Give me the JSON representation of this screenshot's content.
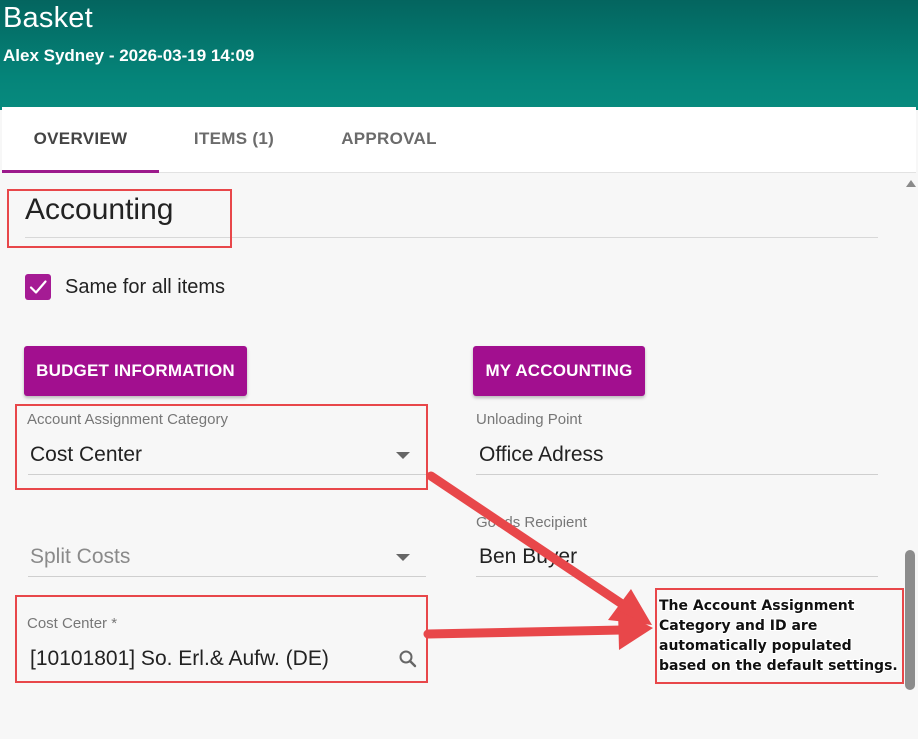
{
  "header": {
    "title": "Basket",
    "subtitle": "Alex Sydney - 2026-03-19 14:09"
  },
  "tabs": [
    {
      "label": "OVERVIEW",
      "active": true
    },
    {
      "label": "ITEMS (1)",
      "active": false
    },
    {
      "label": "APPROVAL",
      "active": false
    }
  ],
  "accounting": {
    "title": "Accounting",
    "same_for_all": {
      "label": "Same for all items",
      "checked": true
    },
    "budget_button": "BUDGET INFORMATION",
    "my_accounting_button": "MY ACCOUNTING",
    "account_assignment": {
      "label": "Account Assignment Category",
      "value": "Cost Center"
    },
    "split_costs": {
      "placeholder": "Split Costs"
    },
    "cost_center": {
      "label": "Cost Center *",
      "value": "[10101801] So. Erl.& Aufw. (DE)"
    },
    "unloading_point": {
      "label": "Unloading Point",
      "value": "Office Adress"
    },
    "goods_recipient": {
      "label": "Goods Recipient",
      "value": "Ben Buyer"
    }
  },
  "annotation": {
    "text": "The Account Assignment Category and ID are automatically populated based on the default settings."
  },
  "colors": {
    "header": "#058479",
    "accent": "#a20f8f",
    "highlight": "#e8474a"
  }
}
